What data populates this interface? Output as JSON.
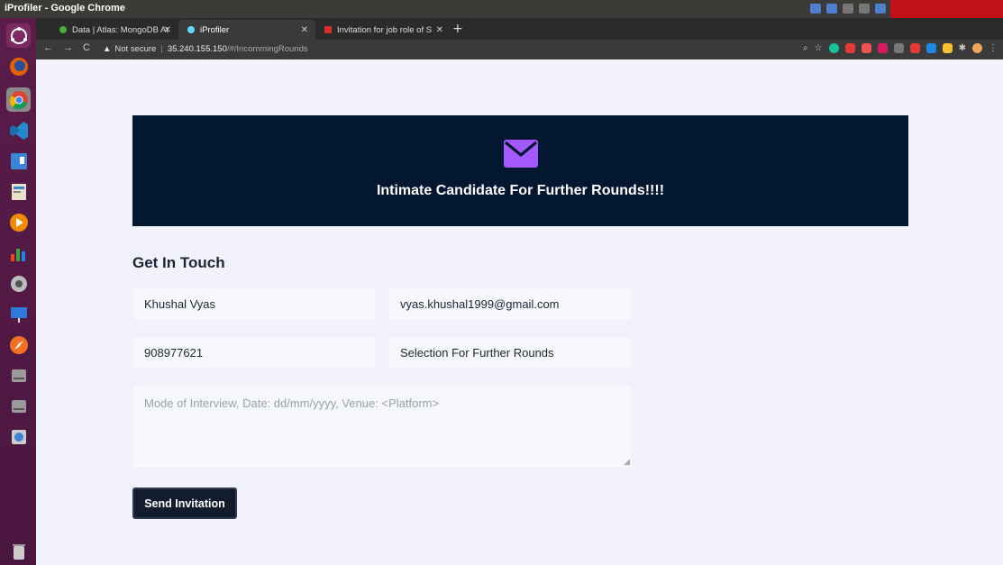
{
  "os": {
    "window_title": "iProfiler - Google Chrome"
  },
  "browser": {
    "tabs": [
      {
        "label": "Data | Atlas: MongoDB At",
        "favicon": "leaf-icon",
        "color": "#4faa41"
      },
      {
        "label": "iProfiler",
        "favicon": "react-icon",
        "color": "#61dafb",
        "active": true
      },
      {
        "label": "Invitation for job role of S",
        "favicon": "gmail-icon",
        "color": "#d93025"
      }
    ],
    "new_tab": "+",
    "security": "Not secure",
    "url_host": "35.240.155.150",
    "url_path": "/#/IncommingRounds"
  },
  "page": {
    "hero_title": "Intimate Candidate For Further Rounds!!!!",
    "accent_color": "#a259ff",
    "section_title": "Get In Touch",
    "form": {
      "name": "Khushal Vyas",
      "email": "vyas.khushal1999@gmail.com",
      "phone": "908977621",
      "subject": "Selection For Further Rounds",
      "message_placeholder": "Mode of Interview, Date: dd/mm/yyyy, Venue: <Platform>"
    },
    "send_label": "Send Invitation"
  }
}
